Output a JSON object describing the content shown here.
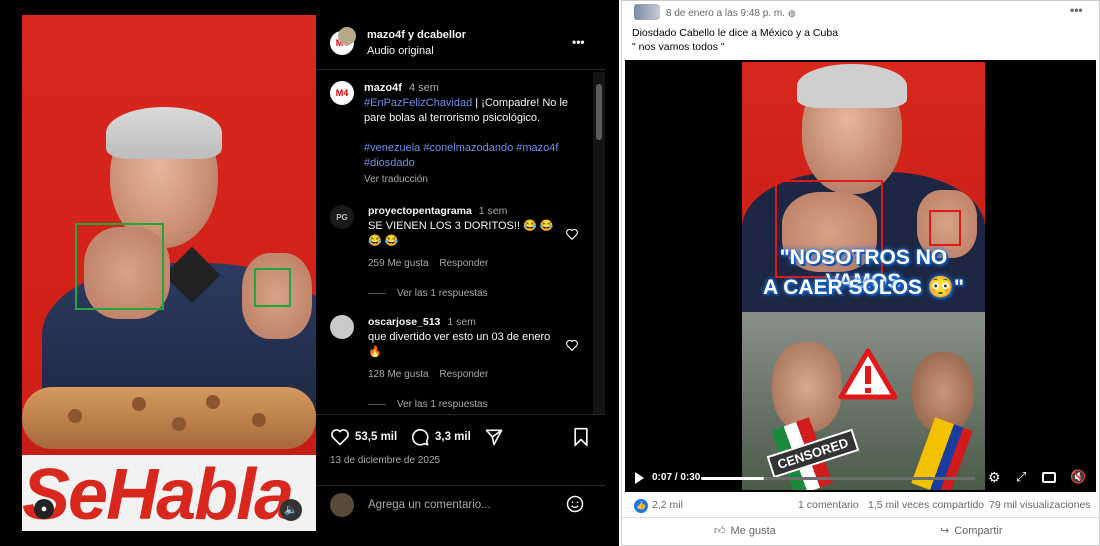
{
  "instagram": {
    "account_header": "mazo4f y dcabellor",
    "audio_label": "Audio original",
    "more_label": "•••",
    "caption": {
      "user": "mazo4f",
      "time": "4 sem",
      "hashtag1": "#EnPazFelizChavidad",
      "text1": " | ¡Compadre! No le pare bolas al terrorismo psicológico.",
      "hashtags2": "#venezuela #conelmazodando #mazo4f #diosdado",
      "translate": "Ver traducción"
    },
    "comments": [
      {
        "user": "proyectopentagrama",
        "time": "1 sem",
        "text": "SE VIENEN LOS 3 DORITOS!! 😂 😂 😂 😂",
        "likes": "259 Me gusta",
        "reply": "Responder",
        "view_replies": "Ver las 1 respuestas"
      },
      {
        "user": "oscarjose_513",
        "time": "1 sem",
        "text": "que divertido ver esto un 03 de enero 🔥",
        "likes": "128 Me gusta",
        "reply": "Responder",
        "view_replies": "Ver las 1 respuestas"
      }
    ],
    "likes_count": "53,5 mil",
    "comments_count": "3,3 mil",
    "date": "13 de diciembre de 2025",
    "comment_placeholder": "Agrega un comentario...",
    "banner_text": "SeHabla"
  },
  "facebook": {
    "timestamp": "8 de enero a las 9:48 p. m. ·",
    "post_line1": "Diosdado Cabello le dice a México y a Cuba",
    "post_line2": "\" nos vamos todos \"",
    "overlay_line1": "\"NOSOTROS NO VAMOS",
    "overlay_line2": "A CAER SOLOS 😳\"",
    "censored_label": "CENSORED",
    "video_time": "0:07 / 0:30",
    "video_progress": 0.23,
    "reactions": "2,2 mil",
    "comments": "1 comentario",
    "shares": "1,5 mil veces compartido",
    "views": "79 mil visualizaciones",
    "like_label": "Me gusta",
    "share_label": "Compartir"
  },
  "colors": {
    "ig_bg": "#000000",
    "fb_bg": "#ffffff",
    "highlight_green": "#1fa83b",
    "highlight_red": "#e01818",
    "hashtag_blue": "#6f8fe9"
  }
}
